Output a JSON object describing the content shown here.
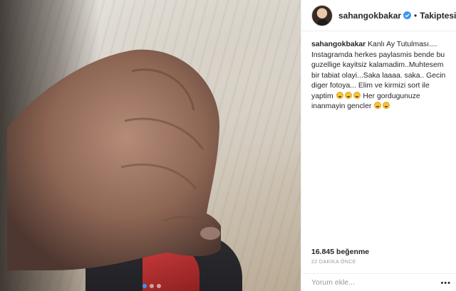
{
  "post": {
    "username": "sahangokbakar",
    "follow_label": "Takiptesin",
    "dot_separator": "•",
    "caption_text": " Kanlı Ay Tutulması.... Instagramda herkes paylasmis bende bu guzellige kayitsiz kalamadim..Muhtesem bir tabiat olayi...Saka laaaa. saka.. Gecin diger fotoya... Elim ve kirmizi sort ile yaptim ",
    "caption_tail": " Her gordugunuze inanmayin gencler ",
    "likes": "16.845 beğenme",
    "time": "22 DAKİKA ÖNCE",
    "comment_placeholder": "Yorum ekle...",
    "more_label": "•••"
  },
  "carousel": {
    "count": 3,
    "active_index": 0
  },
  "colors": {
    "accent_blue": "#3897f0",
    "text": "#262626",
    "muted": "#999999",
    "border": "#efefef"
  },
  "icons": [
    "verified-badge-icon",
    "laughing-emoji-icon",
    "more-options-icon"
  ]
}
